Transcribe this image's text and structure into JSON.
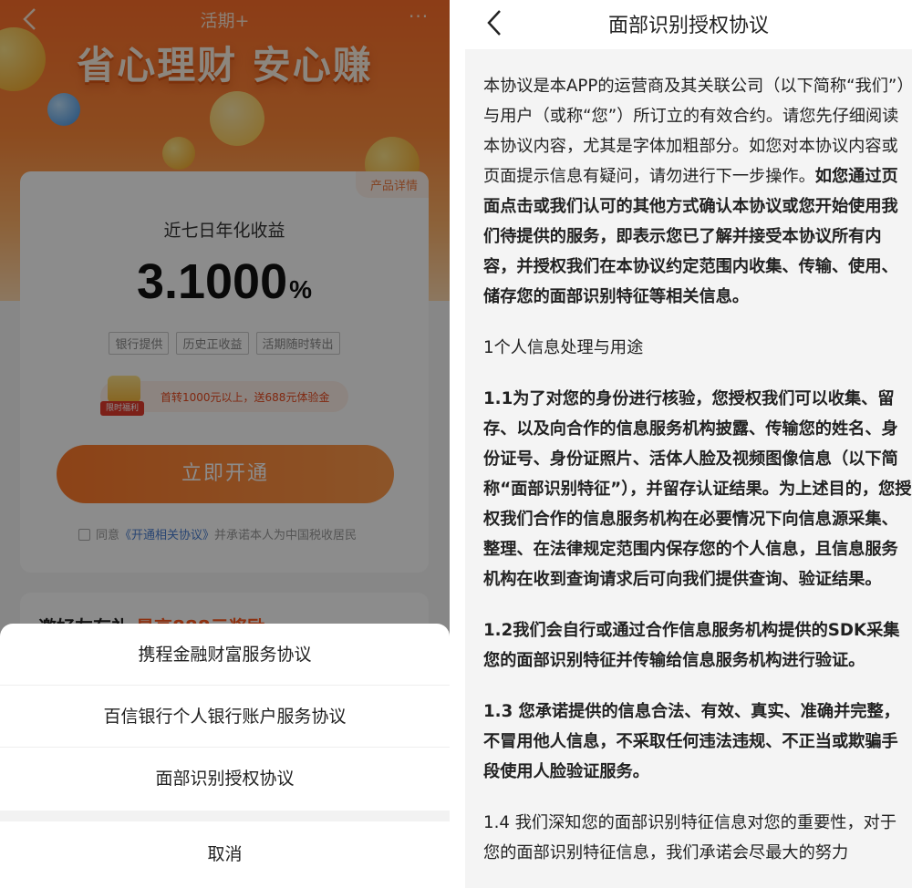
{
  "left": {
    "nav": {
      "title": "活期+",
      "more": "···"
    },
    "slogan": "省心理财 安心赚",
    "card": {
      "product_detail": "产品详情",
      "yield_label": "近七日年化收益",
      "yield_value": "3.1000",
      "yield_unit": "%",
      "tags": [
        "银行提供",
        "历史正收益",
        "活期随时转出"
      ],
      "promo_badge": "限时福利",
      "promo_text": "首转1000元以上，送688元体验金",
      "open_button": "立即开通",
      "agree_prefix": "同意",
      "agree_link": "《开通相关协议》",
      "agree_suffix": "并承诺本人为中国税收居民"
    },
    "second_card": {
      "title": "邀好友有礼",
      "highlight": "最高888元奖励"
    },
    "sheet": {
      "items": [
        "携程金融财富服务协议",
        "百信银行个人银行账户服务协议",
        "面部识别授权协议"
      ],
      "cancel": "取消"
    }
  },
  "right": {
    "title": "面部识别授权协议",
    "p1_normal": "本协议是本APP的运营商及其关联公司（以下简称“我们”）与用户（或称“您”）所订立的有效合约。请您先仔细阅读本协议内容，尤其是字体加粗部分。如您对本协议内容或页面提示信息有疑问，请勿进行下一步操作。",
    "p1_bold": "如您通过页面点击或我们认可的其他方式确认本协议或您开始使用我们待提供的服务，即表示您已了解并接受本协议所有内容，并授权我们在本协议约定范围内收集、传输、使用、储存您的面部识别特征等相关信息。",
    "section1": "1个人信息处理与用途",
    "p1_1": "1.1为了对您的身份进行核验，您授权我们可以收集、留存、以及向合作的信息服务机构披露、传输您的姓名、身份证号、身份证照片、活体人脸及视频图像信息（以下简称“面部识别特征”），并留存认证结果。为上述目的，您授权我们合作的信息服务机构在必要情况下向信息源采集、整理、在法律规定范围内保存您的个人信息，且信息服务机构在收到查询请求后可向我们提供查询、验证结果。",
    "p1_2": "1.2我们会自行或通过合作信息服务机构提供的SDK采集您的面部识别特征并传输给信息服务机构进行验证。",
    "p1_3": "1.3 您承诺提供的信息合法、有效、真实、准确并完整，不冒用他人信息，不采取任何违法违规、不正当或欺骗手段使用人脸验证服务。",
    "p1_4": "1.4 我们深知您的面部识别特征信息对您的重要性，对于您的面部识别特征信息，我们承诺会尽最大的努力"
  },
  "colors": {
    "brand_orange": "#ff7a2b",
    "link_blue": "#4a7fd1",
    "promo_red": "#e9491e"
  }
}
